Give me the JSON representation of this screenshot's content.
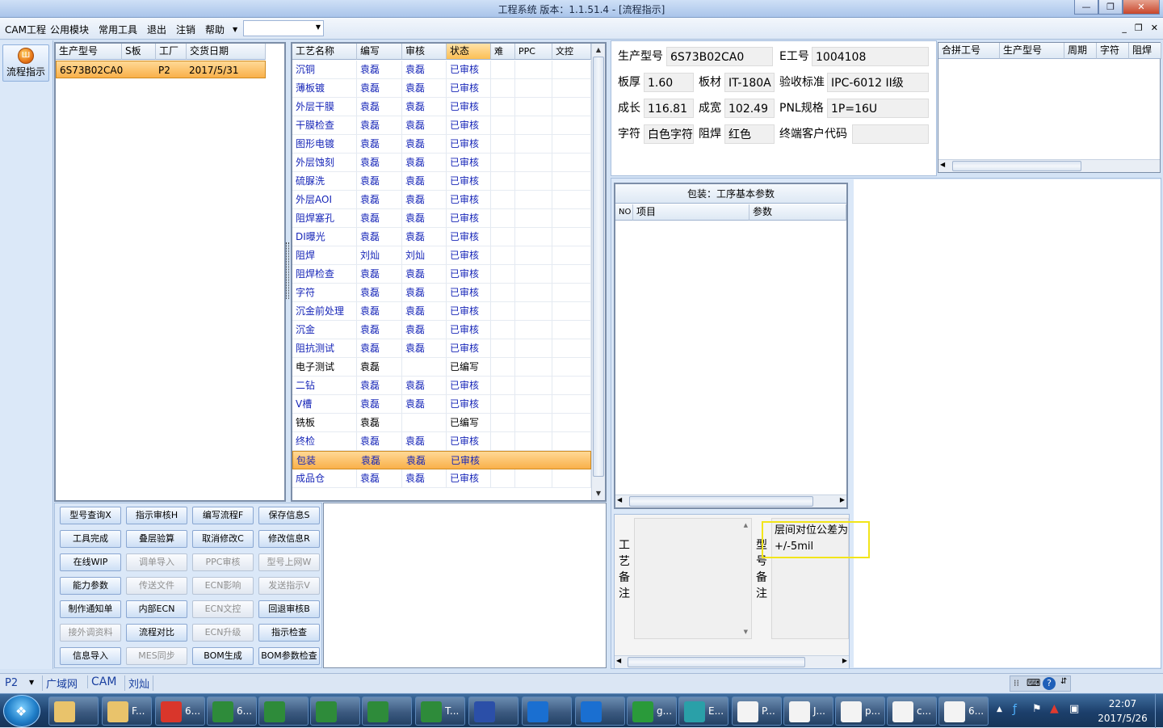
{
  "window": {
    "title": "工程系统    版本：1.1.51.4 - [流程指示]"
  },
  "menu": [
    "CAM工程",
    "公用模块",
    "常用工具",
    "退出",
    "注销",
    "帮助"
  ],
  "launcher": {
    "flow_label": "流程指示"
  },
  "product_list": {
    "columns": [
      "生产型号",
      "S板",
      "工厂",
      "交货日期"
    ],
    "rows": [
      {
        "model": "6S73B02CA0",
        "s": "",
        "factory": "P2",
        "date": "2017/5/31"
      }
    ]
  },
  "process_table": {
    "columns": [
      "工艺名称",
      "编写",
      "审核",
      "状态",
      "难",
      "PPC",
      "文控"
    ],
    "rows": [
      {
        "name": "沉铜",
        "writer": "袁磊",
        "reviewer": "袁磊",
        "status": "已审核"
      },
      {
        "name": "薄板镀",
        "writer": "袁磊",
        "reviewer": "袁磊",
        "status": "已审核"
      },
      {
        "name": "外层干膜",
        "writer": "袁磊",
        "reviewer": "袁磊",
        "status": "已审核"
      },
      {
        "name": "干膜检查",
        "writer": "袁磊",
        "reviewer": "袁磊",
        "status": "已审核"
      },
      {
        "name": "图形电镀",
        "writer": "袁磊",
        "reviewer": "袁磊",
        "status": "已审核"
      },
      {
        "name": "外层蚀刻",
        "writer": "袁磊",
        "reviewer": "袁磊",
        "status": "已审核"
      },
      {
        "name": "硫脲洗",
        "writer": "袁磊",
        "reviewer": "袁磊",
        "status": "已审核"
      },
      {
        "name": "外层AOI",
        "writer": "袁磊",
        "reviewer": "袁磊",
        "status": "已审核"
      },
      {
        "name": "阻焊塞孔",
        "writer": "袁磊",
        "reviewer": "袁磊",
        "status": "已审核"
      },
      {
        "name": "DI曝光",
        "writer": "袁磊",
        "reviewer": "袁磊",
        "status": "已审核"
      },
      {
        "name": "阻焊",
        "writer": "刘灿",
        "reviewer": "刘灿",
        "status": "已审核"
      },
      {
        "name": "阻焊检查",
        "writer": "袁磊",
        "reviewer": "袁磊",
        "status": "已审核"
      },
      {
        "name": "字符",
        "writer": "袁磊",
        "reviewer": "袁磊",
        "status": "已审核"
      },
      {
        "name": "沉金前处理",
        "writer": "袁磊",
        "reviewer": "袁磊",
        "status": "已审核"
      },
      {
        "name": "沉金",
        "writer": "袁磊",
        "reviewer": "袁磊",
        "status": "已审核"
      },
      {
        "name": "阻抗测试",
        "writer": "袁磊",
        "reviewer": "袁磊",
        "status": "已审核"
      },
      {
        "name": "电子测试",
        "writer": "袁磊",
        "reviewer": "",
        "status": "已编写"
      },
      {
        "name": "二钻",
        "writer": "袁磊",
        "reviewer": "袁磊",
        "status": "已审核"
      },
      {
        "name": "V槽",
        "writer": "袁磊",
        "reviewer": "袁磊",
        "status": "已审核"
      },
      {
        "name": "铣板",
        "writer": "袁磊",
        "reviewer": "",
        "status": "已编写"
      },
      {
        "name": "终检",
        "writer": "袁磊",
        "reviewer": "袁磊",
        "status": "已审核"
      },
      {
        "name": "包装",
        "writer": "袁磊",
        "reviewer": "袁磊",
        "status": "已审核"
      },
      {
        "name": "成品仓",
        "writer": "袁磊",
        "reviewer": "袁磊",
        "status": "已审核"
      }
    ],
    "selected_index": 21
  },
  "buttons": [
    [
      "型号查询X",
      "指示审核H",
      "编写流程F",
      "保存信息S"
    ],
    [
      "工具完成",
      "叠层验算",
      "取消修改C",
      "修改信息R"
    ],
    [
      "在线WIP",
      "调单导入",
      "PPC审核",
      "型号上网W"
    ],
    [
      "能力参数",
      "传送文件",
      "ECN影响",
      "发送指示V"
    ],
    [
      "制作通知单",
      "内部ECN",
      "ECN文控",
      "回退审核B"
    ],
    [
      "接外调资料",
      "流程对比",
      "ECN升级",
      "指示检查"
    ],
    [
      "信息导入",
      "MES同步",
      "BOM生成",
      "BOM参数检查"
    ]
  ],
  "buttons_disabled": [
    "调单导入",
    "PPC审核",
    "型号上网W",
    "传送文件",
    "ECN影响",
    "发送指示V",
    "ECN文控",
    "接外调资料",
    "ECN升级",
    "MES同步"
  ],
  "info": {
    "model_label": "生产型号",
    "model": "6S73B02CA0",
    "eno_label": "E工号",
    "eno": "1004108",
    "thickness_label": "板厚",
    "thickness": "1.60",
    "material_label": "板材",
    "material": "IT-180A",
    "standard_label": "验收标准",
    "standard": "IPC-6012 II级",
    "length_label": "成长",
    "length": "116.81",
    "width_label": "成宽",
    "width": "102.49",
    "pnl_label": "PNL规格",
    "pnl": "1P=16U",
    "char_label": "字符",
    "char": "白色字符",
    "mask_label": "阻焊",
    "mask": "红色",
    "customer_label": "终端客户代码",
    "customer": ""
  },
  "merge_table": {
    "columns": [
      "合拼工号",
      "生产型号",
      "周期",
      "字符",
      "阻焊"
    ]
  },
  "param_panel": {
    "title": "包装：工序基本参数",
    "columns": [
      "NO",
      "项目",
      "参数"
    ]
  },
  "remarks": {
    "process_label": [
      "工",
      "艺",
      "备",
      "注"
    ],
    "model_label": [
      "型",
      "号",
      "备",
      "注"
    ],
    "model_text_line1": "层间对位公差为",
    "model_text_line2": "+/-5mil"
  },
  "statusbar": {
    "factory": "P2",
    "network": "广域网",
    "module": "CAM",
    "user": "刘灿"
  },
  "taskbar": {
    "items": [
      "F...",
      "6...",
      "6...",
      "",
      "",
      "",
      "T...",
      "",
      "",
      "",
      "g...",
      "E...",
      "P...",
      "J...",
      "p...",
      "c...",
      "6..."
    ],
    "time": "22:07",
    "date": "2017/5/26"
  },
  "colors": {
    "accent_selected": "#f9b04a",
    "blue_text": "#1726b8",
    "highlight_box": "#f2e51a"
  }
}
